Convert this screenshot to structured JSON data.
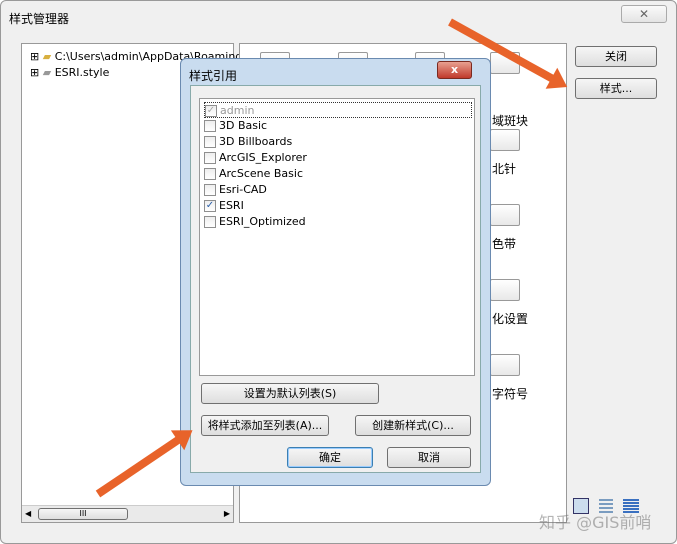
{
  "window": {
    "title": "样式管理器",
    "close_icon": "close-icon"
  },
  "tree": {
    "items": [
      {
        "label": "C:\\Users\\admin\\AppData\\Roaming",
        "icon": "folder-open-icon"
      },
      {
        "label": "ESRI.style",
        "icon": "folder-icon"
      }
    ],
    "scroll_label": "III"
  },
  "folders": {
    "labels": [
      "域斑块",
      "北针",
      "色带",
      "化设置",
      "字符号"
    ]
  },
  "buttons": {
    "close": "关闭",
    "styles": "样式..."
  },
  "dialog": {
    "title": "样式引用",
    "close_label": "x",
    "items": [
      {
        "label": "admin",
        "checked": true,
        "disabled": true
      },
      {
        "label": "3D Basic",
        "checked": false
      },
      {
        "label": "3D Billboards",
        "checked": false
      },
      {
        "label": "ArcGIS_Explorer",
        "checked": false
      },
      {
        "label": "ArcScene Basic",
        "checked": false
      },
      {
        "label": "Esri-CAD",
        "checked": false
      },
      {
        "label": "ESRI",
        "checked": true
      },
      {
        "label": "ESRI_Optimized",
        "checked": false
      }
    ],
    "set_default": "设置为默认列表(S)",
    "add_to_list": "将样式添加至列表(A)...",
    "create_new": "创建新样式(C)...",
    "ok": "确定",
    "cancel": "取消"
  },
  "watermark": "知乎 @GIS前哨",
  "colors": {
    "arrow": "#e8632a",
    "dialog_frame": "#c9dcef"
  }
}
